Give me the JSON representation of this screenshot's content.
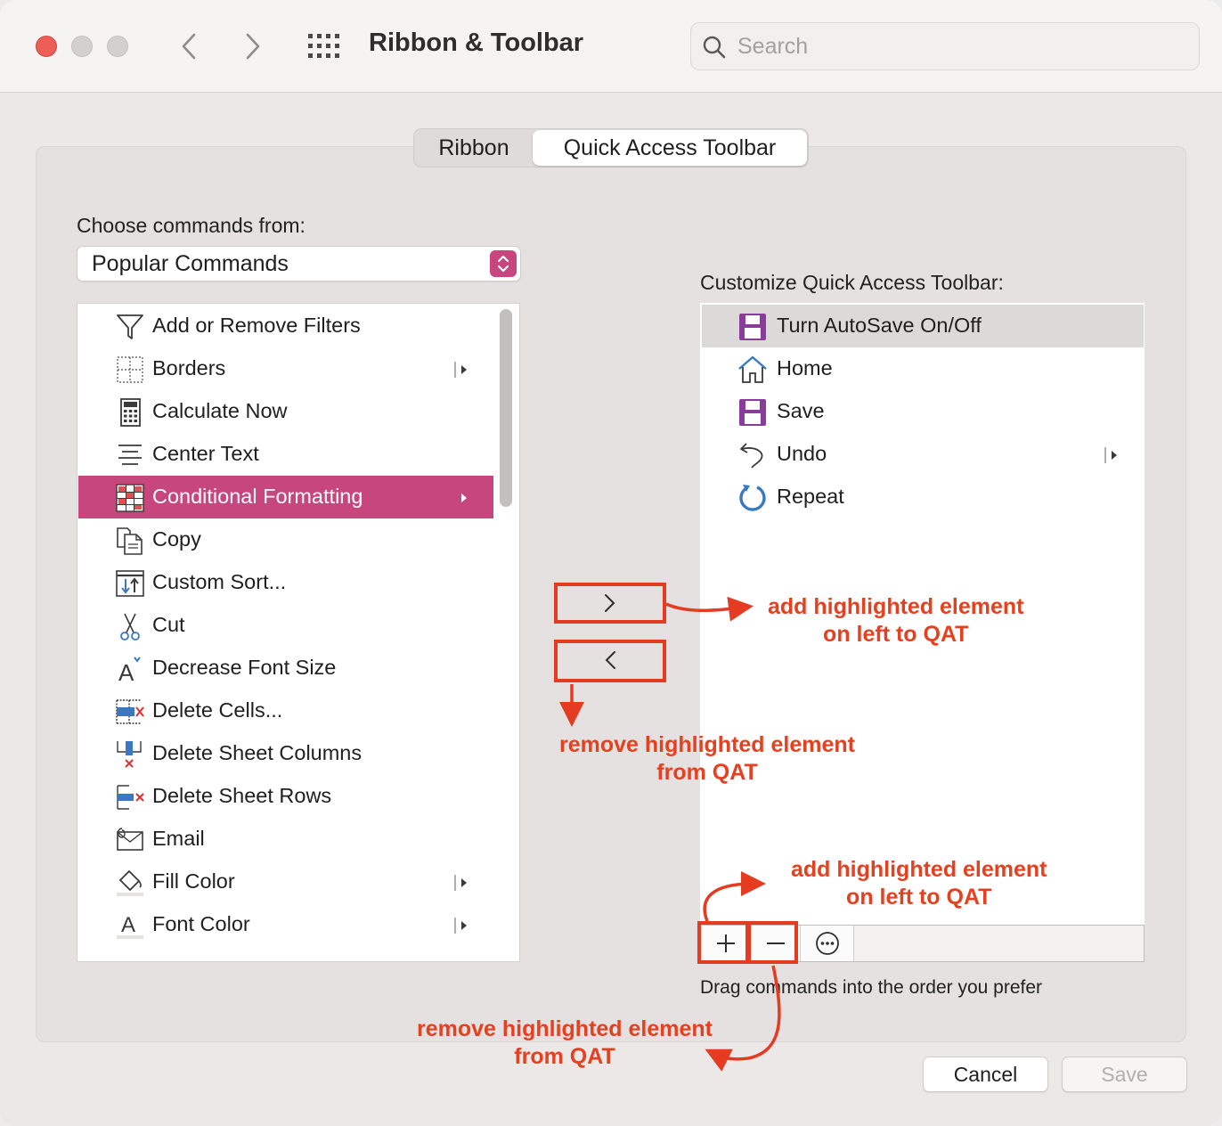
{
  "window": {
    "title": "Ribbon & Toolbar",
    "search_placeholder": "Search"
  },
  "tabs": [
    {
      "label": "Ribbon",
      "selected": false
    },
    {
      "label": "Quick Access Toolbar",
      "selected": true
    }
  ],
  "left_panel": {
    "heading": "Choose commands from:",
    "dropdown_value": "Popular Commands",
    "commands": [
      {
        "label": "Add or Remove Filters",
        "icon": "filter-icon",
        "submenu": false
      },
      {
        "label": "Borders",
        "icon": "borders-icon",
        "submenu": true
      },
      {
        "label": "Calculate Now",
        "icon": "calculator-icon",
        "submenu": false
      },
      {
        "label": "Center Text",
        "icon": "center-text-icon",
        "submenu": false
      },
      {
        "label": "Conditional Formatting",
        "icon": "conditional-formatting-icon",
        "submenu": true,
        "selected": true
      },
      {
        "label": "Copy",
        "icon": "copy-icon",
        "submenu": false
      },
      {
        "label": "Custom Sort...",
        "icon": "sort-icon",
        "submenu": false
      },
      {
        "label": "Cut",
        "icon": "scissors-icon",
        "submenu": false
      },
      {
        "label": "Decrease Font Size",
        "icon": "decrease-font-icon",
        "submenu": false
      },
      {
        "label": "Delete Cells...",
        "icon": "delete-cells-icon",
        "submenu": false
      },
      {
        "label": "Delete Sheet Columns",
        "icon": "delete-columns-icon",
        "submenu": false
      },
      {
        "label": "Delete Sheet Rows",
        "icon": "delete-rows-icon",
        "submenu": false
      },
      {
        "label": "Email",
        "icon": "email-icon",
        "submenu": false
      },
      {
        "label": "Fill Color",
        "icon": "fill-color-icon",
        "submenu": true
      },
      {
        "label": "Font Color",
        "icon": "font-color-icon",
        "submenu": true
      }
    ]
  },
  "right_panel": {
    "heading": "Customize Quick Access Toolbar:",
    "items": [
      {
        "label": "Turn AutoSave On/Off",
        "icon": "autosave-icon",
        "submenu": false,
        "selected": true
      },
      {
        "label": "Home",
        "icon": "home-icon",
        "submenu": false
      },
      {
        "label": "Save",
        "icon": "save-icon",
        "submenu": false
      },
      {
        "label": "Undo",
        "icon": "undo-icon",
        "submenu": true
      },
      {
        "label": "Repeat",
        "icon": "repeat-icon",
        "submenu": false
      }
    ],
    "hint": "Drag commands into the order you prefer"
  },
  "annotations": {
    "add_middle": [
      "add highlighted element",
      "on left to QAT"
    ],
    "remove_middle": [
      "remove highlighted element",
      "from QAT"
    ],
    "add_bottom": [
      "add highlighted element",
      "on left to QAT"
    ],
    "remove_bottom": [
      "remove highlighted element",
      "from QAT"
    ]
  },
  "buttons": {
    "cancel": "Cancel",
    "save": "Save"
  },
  "colors": {
    "accent": "#c8467e",
    "annotation": "#e53b21",
    "icon_purple": "#8a3c9a",
    "icon_blue": "#3a78c2"
  }
}
